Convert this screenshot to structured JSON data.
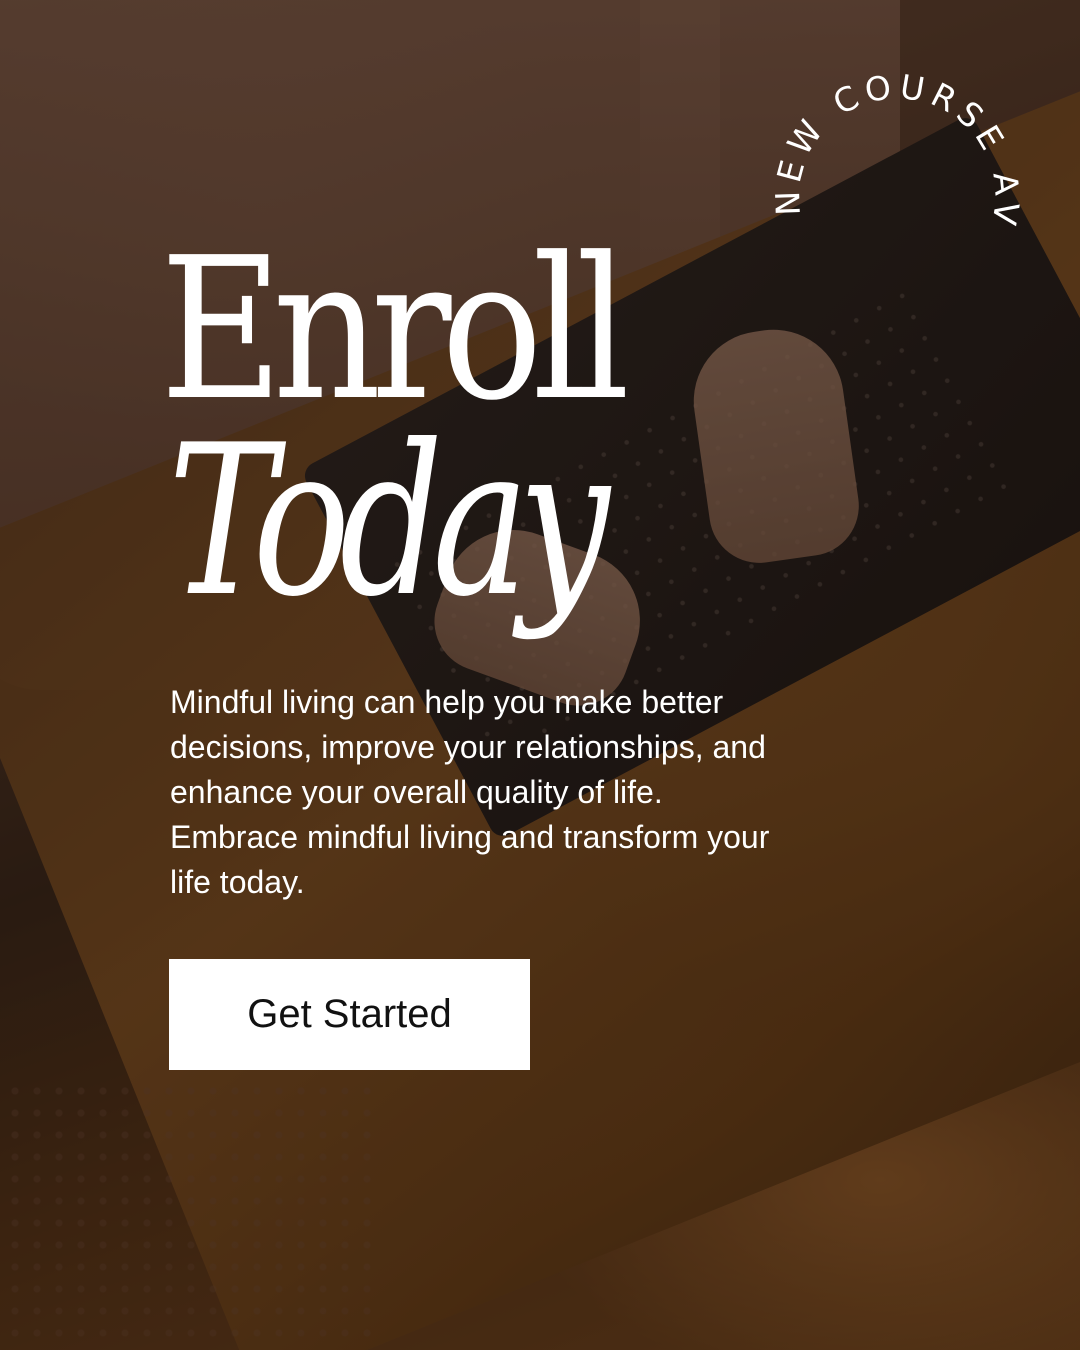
{
  "headline": {
    "line1": "Enroll",
    "line2": "Today"
  },
  "badge": {
    "text": "NEW COURSE AVAILABLE"
  },
  "description": "Mindful living can help you make better decisions, improve your relationships, and enhance your overall quality of life. Embrace mindful living and transform your life today.",
  "cta": {
    "label": "Get Started"
  },
  "colors": {
    "text": "#ffffff",
    "button_background": "#ffffff",
    "button_text": "#111111"
  }
}
